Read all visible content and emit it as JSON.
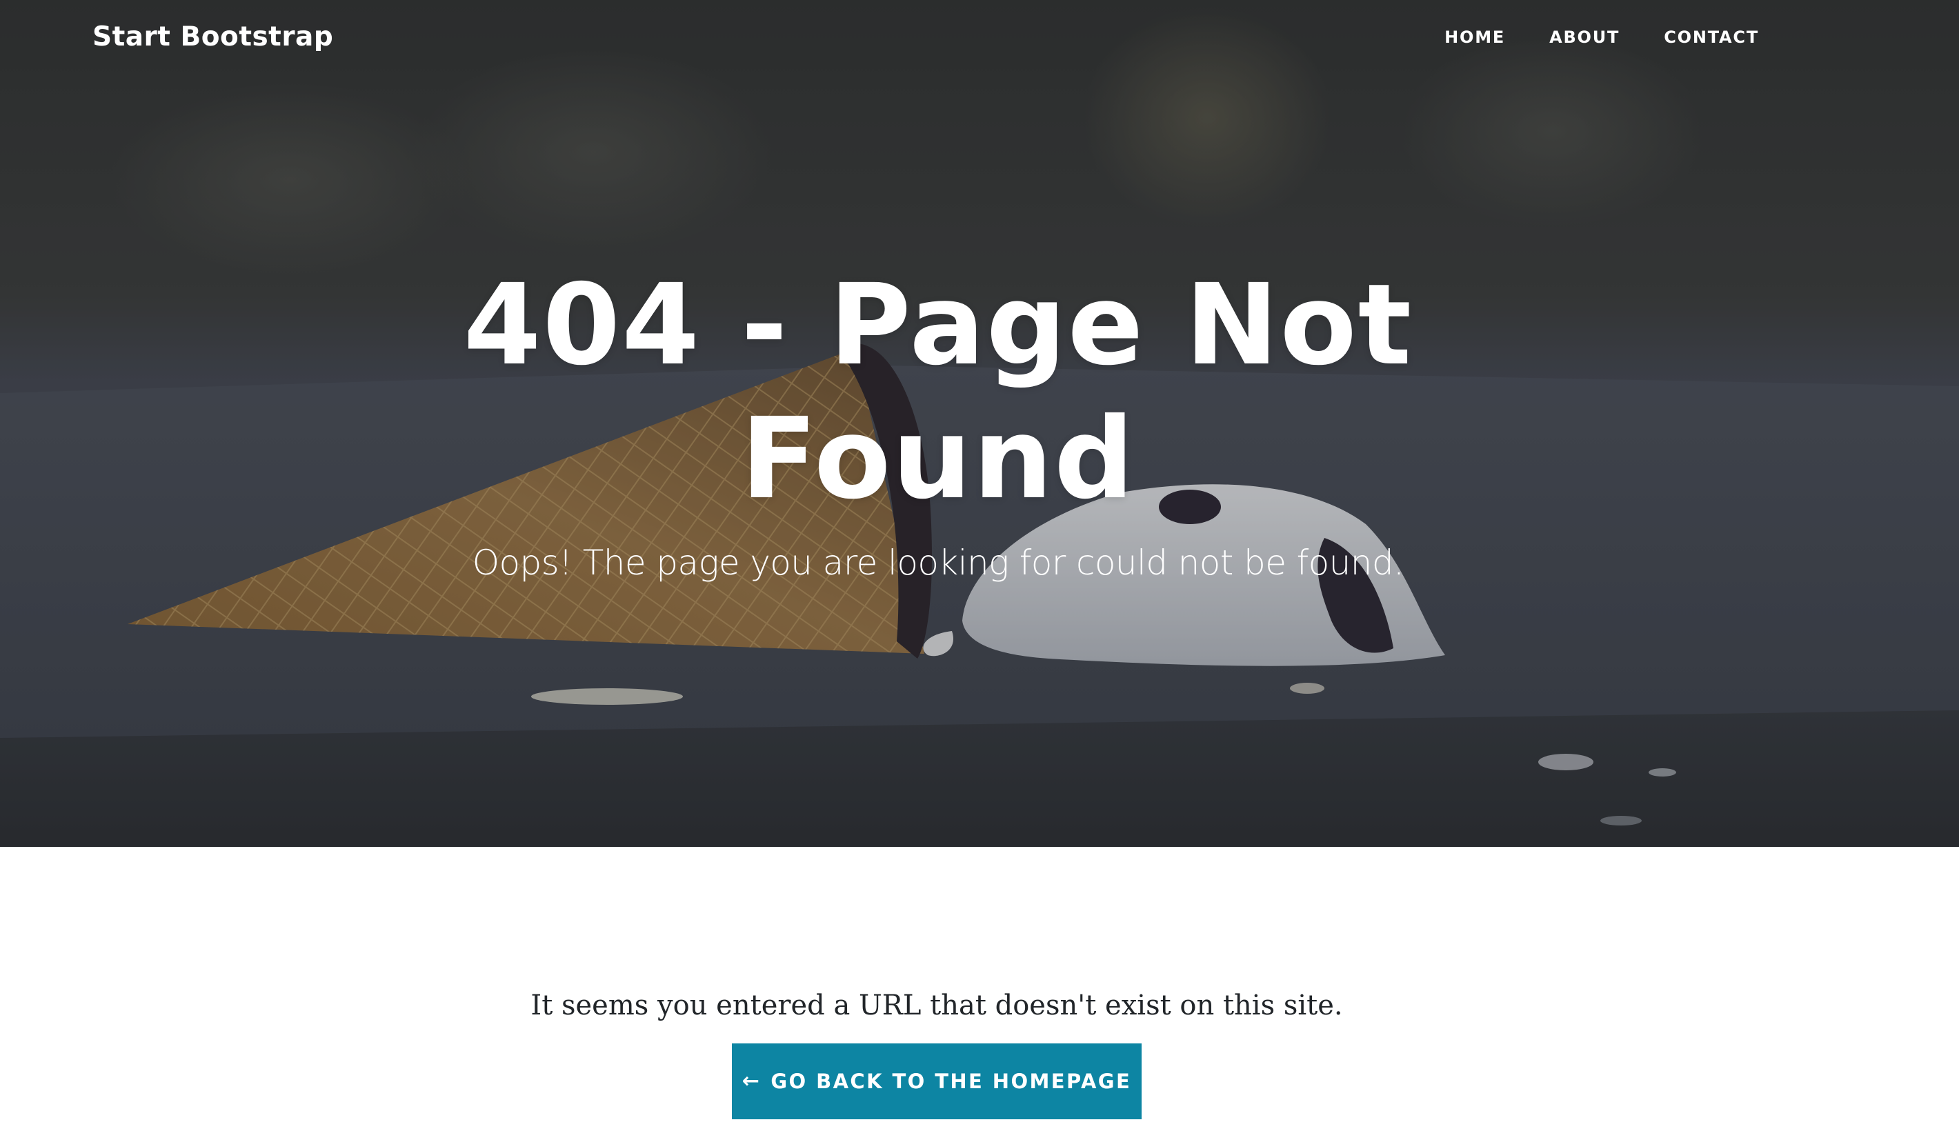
{
  "navbar": {
    "brand": "Start Bootstrap",
    "links": [
      "HOME",
      "ABOUT",
      "CONTACT"
    ]
  },
  "hero": {
    "title": "404 - Page Not Found",
    "subtitle": "Oops! The page you are looking for could not be found.",
    "background_image": "melted-ice-cream-cone"
  },
  "content": {
    "message": "It seems you entered a URL that doesn't exist on this site.",
    "button_icon": "←",
    "button_label": "GO BACK TO THE HOMEPAGE"
  },
  "colors": {
    "button": "#0d85a3",
    "text": "#212529",
    "hero_overlay": "#3d4044"
  }
}
